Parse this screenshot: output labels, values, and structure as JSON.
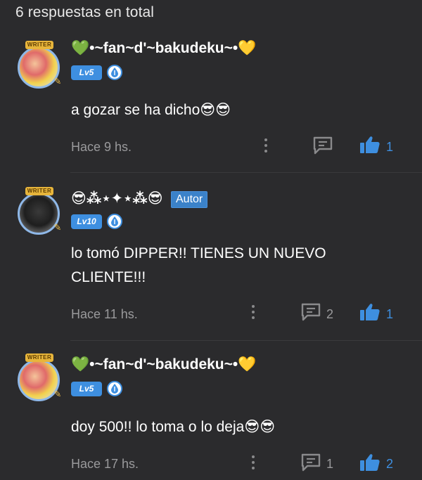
{
  "header": {
    "total_label": "6 respuestas en total"
  },
  "colors": {
    "background": "#2b2b2d",
    "accent_blue": "#3e8fe0",
    "muted_text": "#9a9a9c",
    "writer_gold": "#e7b53b"
  },
  "comments": [
    {
      "username": "💚•~fan~d'~bakudeku~•💛",
      "level": "Lv5",
      "is_author": false,
      "writer_badge": "WRITER",
      "text": "a gozar se ha dicho😎😎",
      "time": "Hace 9 hs.",
      "replies": "",
      "likes": "1"
    },
    {
      "username": "😎⁂⋆✦⋆⁂😎",
      "author_badge": "Autor",
      "level": "Lv10",
      "is_author": true,
      "writer_badge": "WRITER",
      "text": "lo tomó DIPPER!! TIENES UN NUEVO CLIENTE!!!",
      "time": "Hace 11 hs.",
      "replies": "2",
      "likes": "1"
    },
    {
      "username": "💚•~fan~d'~bakudeku~•💛",
      "level": "Lv5",
      "is_author": false,
      "writer_badge": "WRITER",
      "text": "doy 500!! lo toma o lo deja😎😎",
      "time": "Hace 17 hs.",
      "replies": "1",
      "likes": "2"
    }
  ],
  "icons": {
    "more": "more-vertical-icon",
    "reply": "comment-bubble-icon",
    "like": "thumbs-up-icon",
    "level_drop": "water-drop-icon",
    "pen": "pen-icon"
  }
}
